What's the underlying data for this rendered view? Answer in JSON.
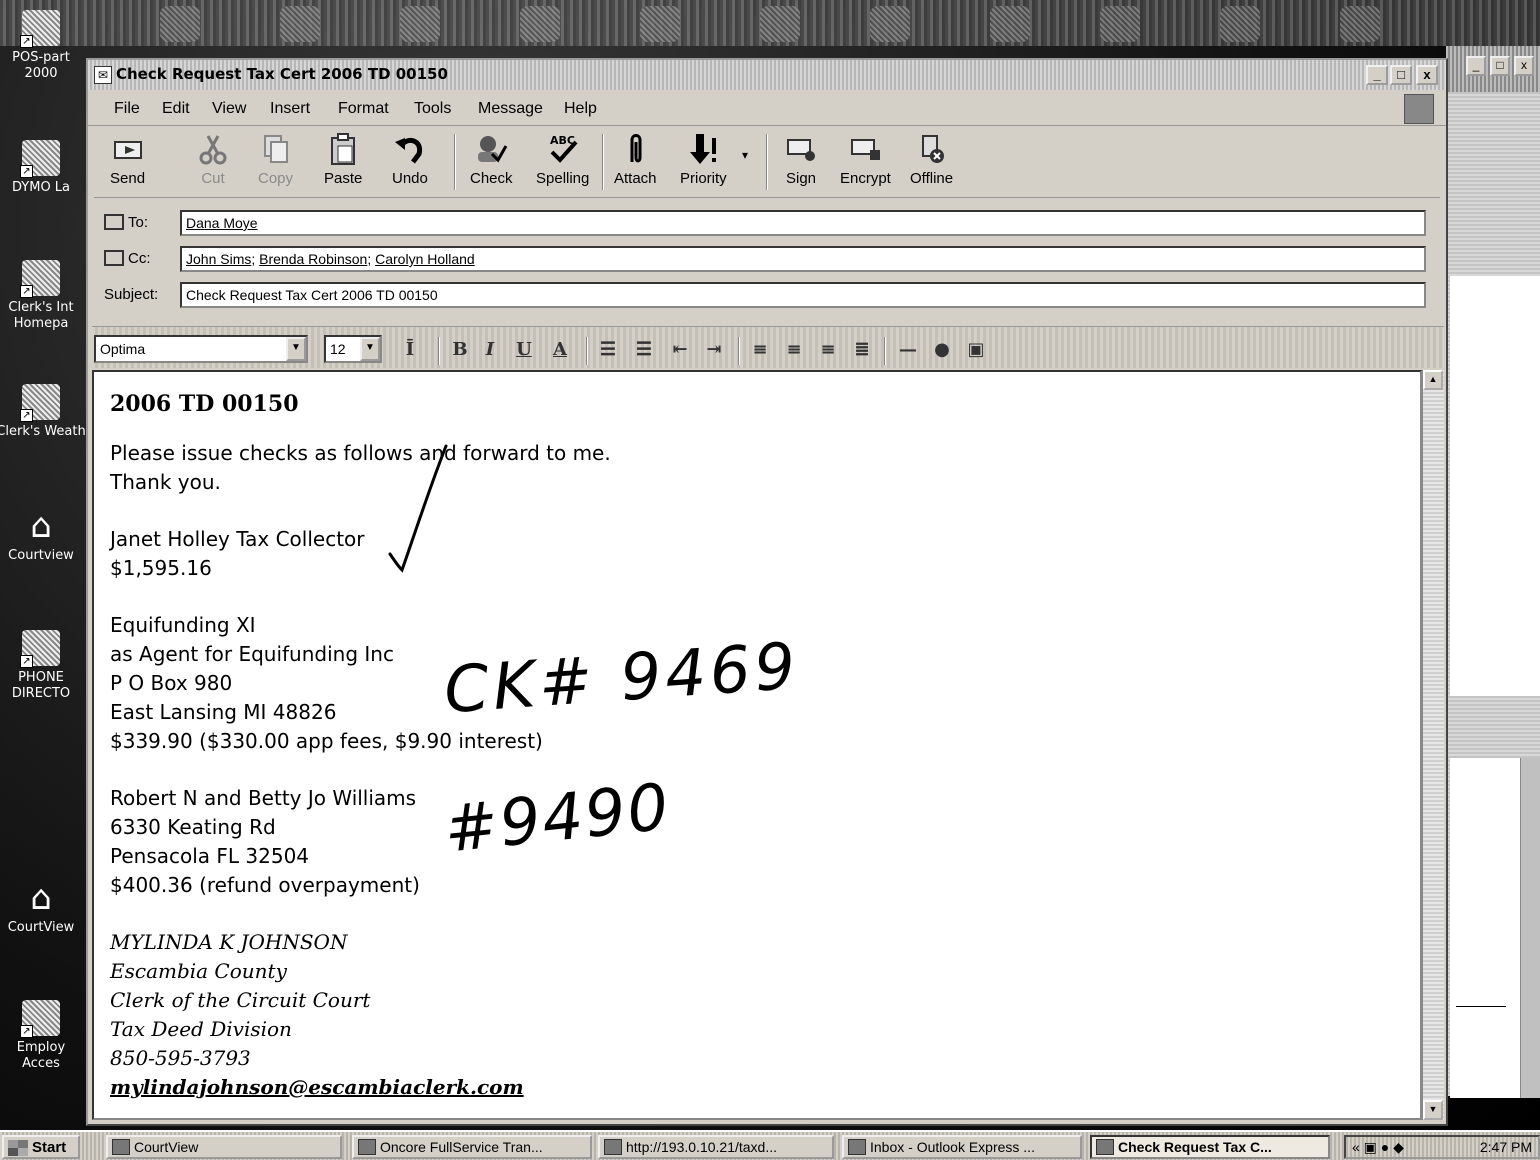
{
  "desktop": {
    "icons": [
      {
        "label": "POS-part 2000"
      },
      {
        "label": "DYMO La"
      },
      {
        "label": "Clerk's Int Homepa"
      },
      {
        "label": "Clerk's Weath"
      },
      {
        "label": "Courtview"
      },
      {
        "label": "PHONE DIRECTO"
      },
      {
        "label": "CourtView"
      },
      {
        "label": "Employ Acces"
      }
    ]
  },
  "window": {
    "title": "Check Request Tax Cert 2006 TD 00150",
    "controls": {
      "minimize": "_",
      "maximize": "□",
      "close": "x"
    }
  },
  "menu": [
    "File",
    "Edit",
    "View",
    "Insert",
    "Format",
    "Tools",
    "Message",
    "Help"
  ],
  "toolbar": {
    "send": "Send",
    "cut": "Cut",
    "copy": "Copy",
    "paste": "Paste",
    "undo": "Undo",
    "check": "Check",
    "spelling": "Spelling",
    "attach": "Attach",
    "priority": "Priority",
    "sign": "Sign",
    "encrypt": "Encrypt",
    "offline": "Offline"
  },
  "headers": {
    "to_label": "To:",
    "to": "Dana Moye",
    "cc_label": "Cc:",
    "cc": [
      "John Sims",
      "Brenda Robinson",
      "Carolyn Holland"
    ],
    "subject_label": "Subject:",
    "subject": "Check Request Tax Cert 2006 TD 00150"
  },
  "format": {
    "font": "Optima",
    "size": "12"
  },
  "message": {
    "heading": "2006 TD 00150",
    "intro": [
      "Please issue checks as follows and forward to me.",
      "Thank you."
    ],
    "payee1": [
      "Janet Holley Tax Collector",
      "$1,595.16"
    ],
    "payee2": [
      "Equifunding XI",
      "as Agent for Equifunding Inc",
      "P O Box 980",
      "East Lansing MI 48826",
      "$339.90 ($330.00 app fees, $9.90 interest)"
    ],
    "payee3": [
      "Robert N and Betty Jo Williams",
      "6330 Keating Rd",
      "Pensacola FL 32504",
      "$400.36 (refund overpayment)"
    ],
    "signature": [
      "MYLINDA K JOHNSON",
      "Escambia County",
      "Clerk of the Circuit Court",
      "Tax Deed Division",
      "850-595-3793"
    ],
    "email": "mylindajohnson@escambiaclerk.com"
  },
  "handwriting": {
    "note1": "CK# 9469",
    "note2": "#9490"
  },
  "taskbar": {
    "start": "Start",
    "tasks": [
      "CourtView",
      "Oncore FullService Tran...",
      "http://193.0.10.21/taxd...",
      "Inbox - Outlook Express ...",
      "Check Request Tax C..."
    ],
    "clock": "2:47 PM"
  }
}
